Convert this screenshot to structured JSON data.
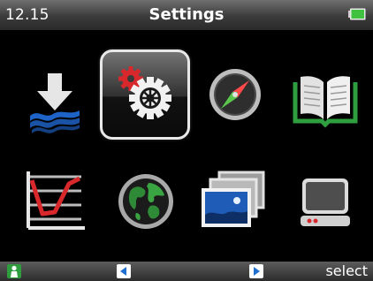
{
  "status": {
    "time": "12.15",
    "title": "Settings",
    "battery_color": "#3fc23f"
  },
  "grid": {
    "items": [
      {
        "icon": "download-waves-icon",
        "selected": false
      },
      {
        "icon": "settings-gears-icon",
        "selected": true
      },
      {
        "icon": "compass-icon",
        "selected": false
      },
      {
        "icon": "open-book-icon",
        "selected": false
      },
      {
        "icon": "line-chart-icon",
        "selected": false
      },
      {
        "icon": "globe-icon",
        "selected": false
      },
      {
        "icon": "photos-icon",
        "selected": false
      },
      {
        "icon": "monitor-icon",
        "selected": false
      }
    ]
  },
  "softkeys": {
    "left_icon": "person-icon",
    "prev_icon": "arrow-left-icon",
    "next_icon": "arrow-right-icon",
    "right_label": "select"
  },
  "colors": {
    "accent_blue": "#1e6fd0",
    "accent_green": "#2e9e3e",
    "accent_red": "#d8282c"
  }
}
